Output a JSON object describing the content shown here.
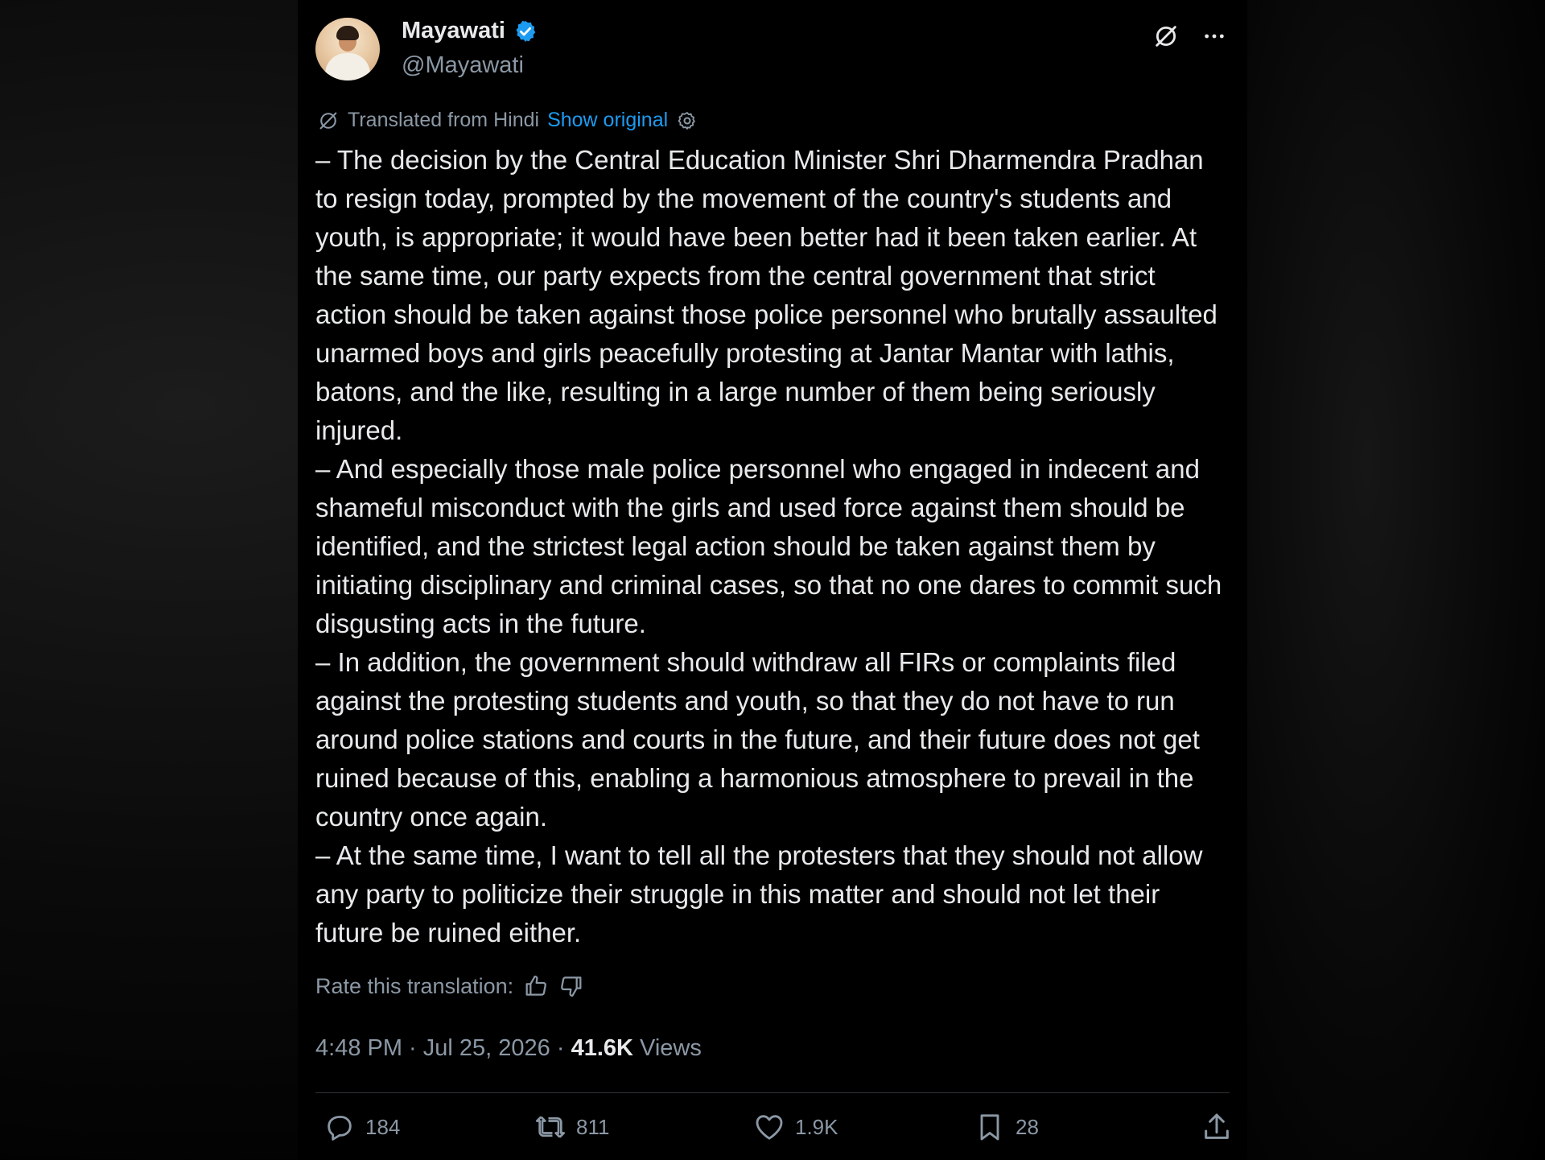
{
  "author": {
    "name": "Mayawati",
    "handle": "@Mayawati",
    "verified_color": "#1d9bf0"
  },
  "translation": {
    "label": "Translated from Hindi",
    "show_original": "Show original"
  },
  "paragraphs": [
    "– The decision by the Central Education Minister Shri Dharmendra Pradhan to resign today, prompted by the movement of the country's students and youth, is appropriate; it would have been better had it been taken earlier. At the same time, our party expects from the central government that strict action should be taken against those police personnel who brutally assaulted unarmed boys and girls peacefully protesting at Jantar Mantar with lathis, batons, and the like, resulting in a large number of them being seriously injured.",
    "– And especially those male police personnel who engaged in indecent and shameful misconduct with the girls and used force against them should be identified, and the strictest legal action should be taken against them by initiating disciplinary and criminal cases, so that no one dares to commit such disgusting acts in the future.",
    "– In addition, the government should withdraw all FIRs or complaints filed against the protesting students and youth, so that they do not have to run around police stations and courts in the future, and their future does not get ruined because of this, enabling a harmonious atmosphere to prevail in the country once again.",
    "– At the same time, I want to tell all the protesters that they should not allow any party to politicize their struggle in this matter and should not let their future be ruined either."
  ],
  "rate": {
    "label": "Rate this translation:"
  },
  "meta": {
    "time": "4:48 PM",
    "separator": " · ",
    "date": "Jul 25, 2026",
    "views_count": "41.6K",
    "views_label": " Views"
  },
  "actions": {
    "replies": "184",
    "reposts": "811",
    "likes": "1.9K",
    "bookmarks": "28"
  },
  "icons": {
    "grok": "grok-icon",
    "more": "more-options-icon",
    "translate": "translate-icon",
    "settings": "settings-icon",
    "thumbs_up": "thumbs-up-icon",
    "thumbs_down": "thumbs-down-icon",
    "reply": "reply-icon",
    "repost": "repost-icon",
    "like": "heart-icon",
    "bookmark": "bookmark-icon",
    "share": "share-icon"
  }
}
